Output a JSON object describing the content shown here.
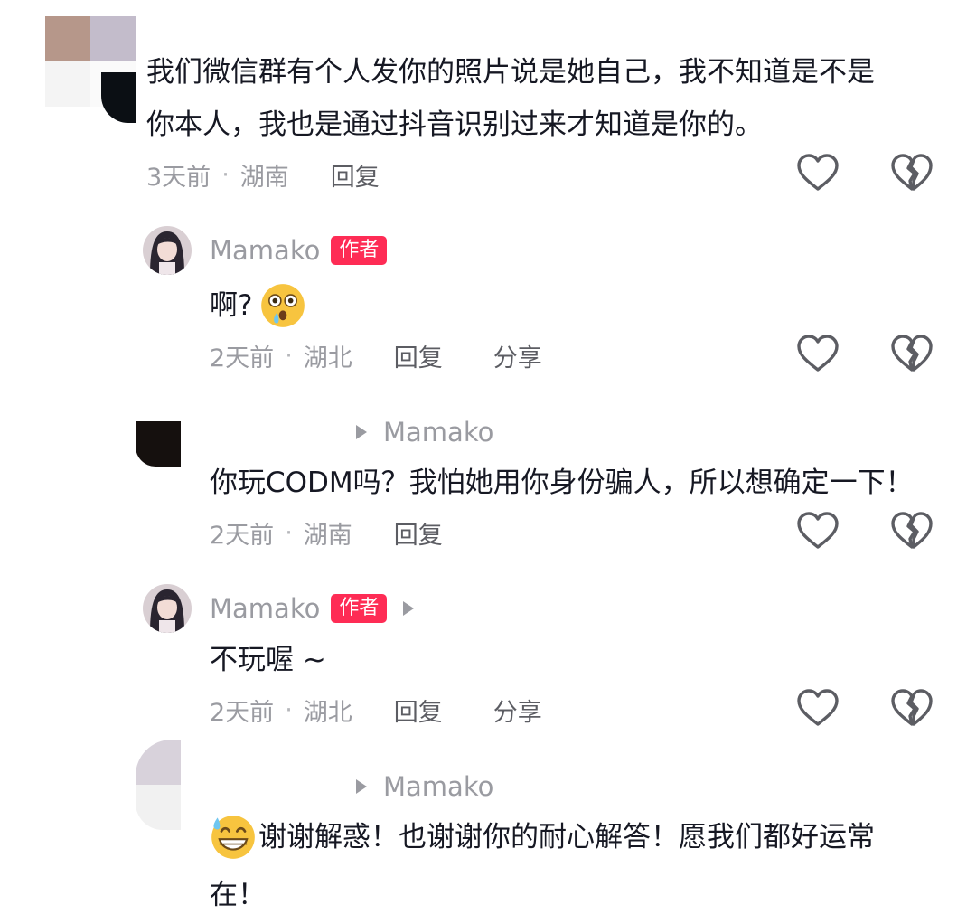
{
  "comments": [
    {
      "text_lines": [
        "我们微信群有个人发你的照片说是她自己，我不知道是不是",
        "你本人，我也是通过抖音识别过来才知道是你的。"
      ],
      "time": "3天前",
      "location": "湖南",
      "reply_label": "回复"
    }
  ],
  "replies": [
    {
      "author": "Mamako",
      "badge": "作者",
      "text": "啊?",
      "emoji": "astonished-face-emoji",
      "time": "2天前",
      "location": "湖北",
      "reply_label": "回复",
      "share_label": "分享"
    },
    {
      "reply_to": "Mamako",
      "text": "你玩CODM吗？我怕她用你身份骗人，所以想确定一下！",
      "time": "2天前",
      "location": "湖南",
      "reply_label": "回复"
    },
    {
      "author": "Mamako",
      "badge": "作者",
      "text": "不玩喔 ~",
      "time": "2天前",
      "location": "湖北",
      "reply_label": "回复",
      "share_label": "分享"
    },
    {
      "reply_to": "Mamako",
      "emoji": "grinning-sweat-face-emoji",
      "text_lines": [
        "谢谢解惑！也谢谢你的耐心解答！愿我们都好运常",
        "在！"
      ]
    }
  ],
  "icons": {
    "like": "heart-outline-icon",
    "dislike": "broken-heart-icon",
    "reply_arrow": "play-arrow-icon"
  },
  "colors": {
    "badge": "#fe2c55",
    "text": "#161823",
    "meta": "#9a9ba1"
  }
}
